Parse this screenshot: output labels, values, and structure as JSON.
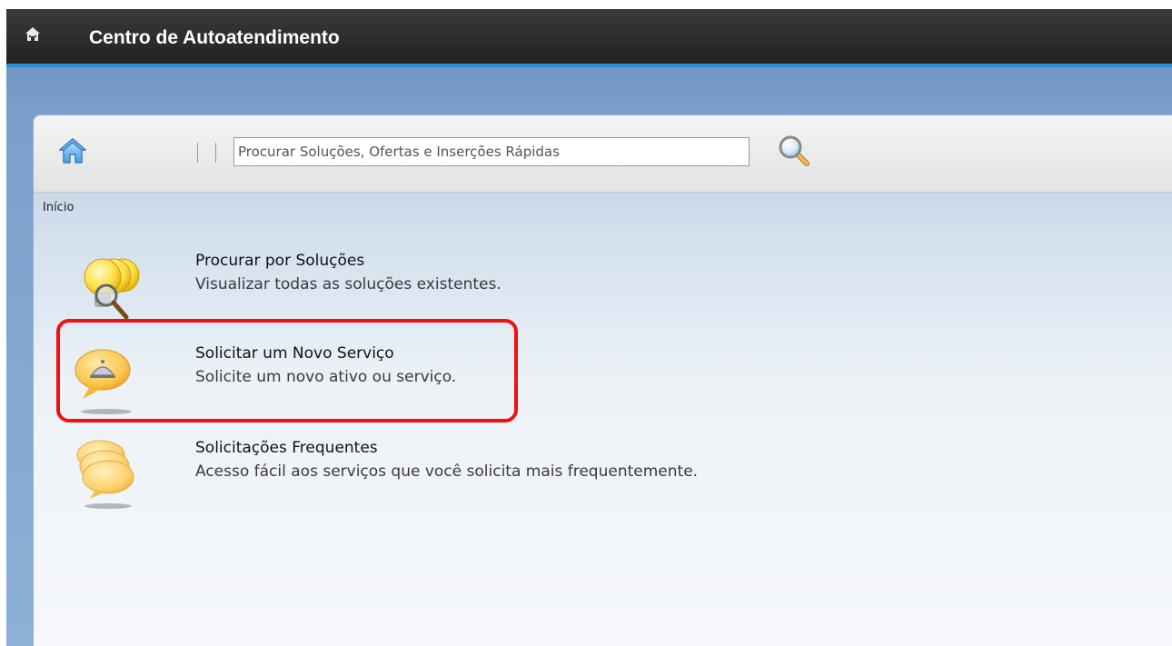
{
  "header": {
    "title": "Centro de Autoatendimento",
    "home_icon": "home-icon"
  },
  "toolbar": {
    "home_icon": "home-icon",
    "search": {
      "placeholder": "Procurar Soluções, Ofertas e Inserções Rápidas",
      "value": ""
    },
    "search_icon": "magnifier-icon"
  },
  "breadcrumb": "Início",
  "items": [
    {
      "title": "Procurar por Soluções",
      "description": "Visualizar todas as soluções existentes.",
      "icon": "lightbulb-search-icon"
    },
    {
      "title": "Solicitar um Novo Serviço",
      "description": "Solicite um novo ativo ou serviço.",
      "icon": "service-bell-icon"
    },
    {
      "title": "Solicitações Frequentes",
      "description": "Acesso fácil aos serviços que você solicita mais frequentemente.",
      "icon": "speech-bubbles-icon"
    }
  ],
  "colors": {
    "topbar": "#2b2b2b",
    "accent_line": "#2d8fd0",
    "background_blue": "#7aa0cc",
    "highlight": "#ee1111"
  }
}
